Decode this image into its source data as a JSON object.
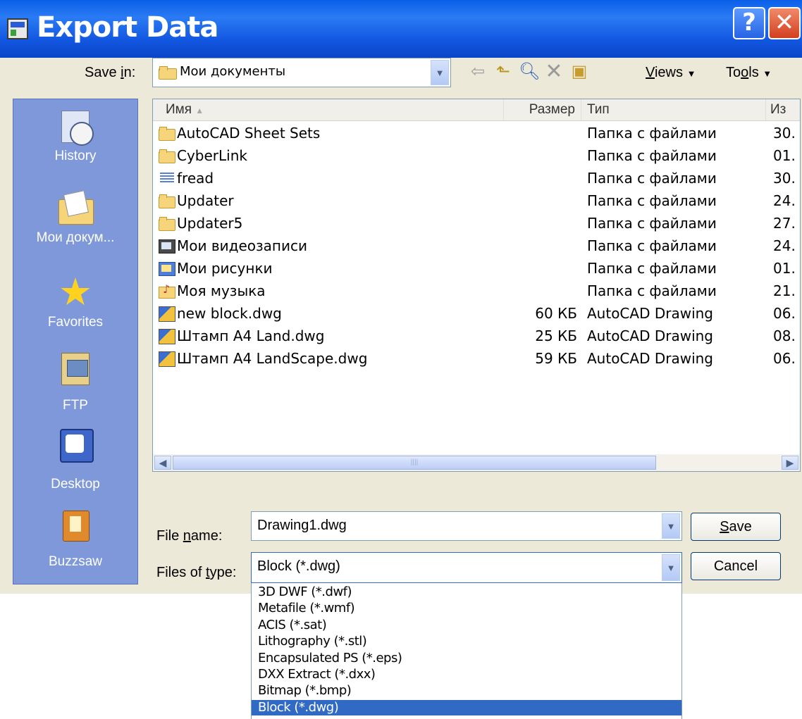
{
  "title": "Export Data",
  "title_buttons": {
    "help": "?",
    "close": "✕"
  },
  "save_in": {
    "label_pre": "Save ",
    "label_key": "i",
    "label_post": "n:",
    "value": "Мои документы"
  },
  "toolbar": {
    "views_key": "V",
    "views_rest": "iews",
    "tools_pre": "To",
    "tools_key": "o",
    "tools_post": "ls"
  },
  "places": [
    {
      "label": "History",
      "icon": "history-icon"
    },
    {
      "label": "Мои докум...",
      "icon": "documents-icon"
    },
    {
      "label": "Favorites",
      "icon": "favorites-icon"
    },
    {
      "label": "FTP",
      "icon": "ftp-icon"
    },
    {
      "label": "Desktop",
      "icon": "desktop-icon"
    },
    {
      "label": "Buzzsaw",
      "icon": "buzzsaw-icon"
    }
  ],
  "columns": {
    "name": "Имя",
    "size": "Размер",
    "type": "Тип",
    "modified": "Из"
  },
  "files": [
    {
      "name": "AutoCAD Sheet Sets",
      "size": "",
      "type": "Папка с файлами",
      "modified": "30.",
      "icon": "folder"
    },
    {
      "name": "CyberLink",
      "size": "",
      "type": "Папка с файлами",
      "modified": "01.",
      "icon": "folder"
    },
    {
      "name": "fread",
      "size": "",
      "type": "Папка с файлами",
      "modified": "30.",
      "icon": "stack"
    },
    {
      "name": "Updater",
      "size": "",
      "type": "Папка с файлами",
      "modified": "24.",
      "icon": "folder"
    },
    {
      "name": "Updater5",
      "size": "",
      "type": "Папка с файлами",
      "modified": "27.",
      "icon": "folder"
    },
    {
      "name": "Мои видеозаписи",
      "size": "",
      "type": "Папка с файлами",
      "modified": "24.",
      "icon": "video"
    },
    {
      "name": "Мои рисунки",
      "size": "",
      "type": "Папка с файлами",
      "modified": "01.",
      "icon": "pic"
    },
    {
      "name": "Моя музыка",
      "size": "",
      "type": "Папка с файлами",
      "modified": "21.",
      "icon": "music"
    },
    {
      "name": "new block.dwg",
      "size": "60 КБ",
      "type": "AutoCAD Drawing",
      "modified": "06.",
      "icon": "dwg"
    },
    {
      "name": "Штамп A4 Land.dwg",
      "size": "25 КБ",
      "type": "AutoCAD Drawing",
      "modified": "08.",
      "icon": "dwg"
    },
    {
      "name": "Штамп A4 LandScape.dwg",
      "size": "59 КБ",
      "type": "AutoCAD Drawing",
      "modified": "06.",
      "icon": "dwg"
    }
  ],
  "file_name": {
    "label_pre": "File ",
    "label_key": "n",
    "label_post": "ame:",
    "value": "Drawing1.dwg"
  },
  "file_type": {
    "label_pre": "Files of ",
    "label_key": "t",
    "label_post": "ype:",
    "value": "Block (*.dwg)"
  },
  "buttons": {
    "save_key": "S",
    "save_rest": "ave",
    "cancel": "Cancel"
  },
  "type_options": [
    "3D DWF (*.dwf)",
    "Metafile (*.wmf)",
    "ACIS (*.sat)",
    "Lithography (*.stl)",
    "Encapsulated PS (*.eps)",
    "DXX Extract (*.dxx)",
    "Bitmap (*.bmp)",
    "Block (*.dwg)"
  ],
  "selected_type_index": 7
}
